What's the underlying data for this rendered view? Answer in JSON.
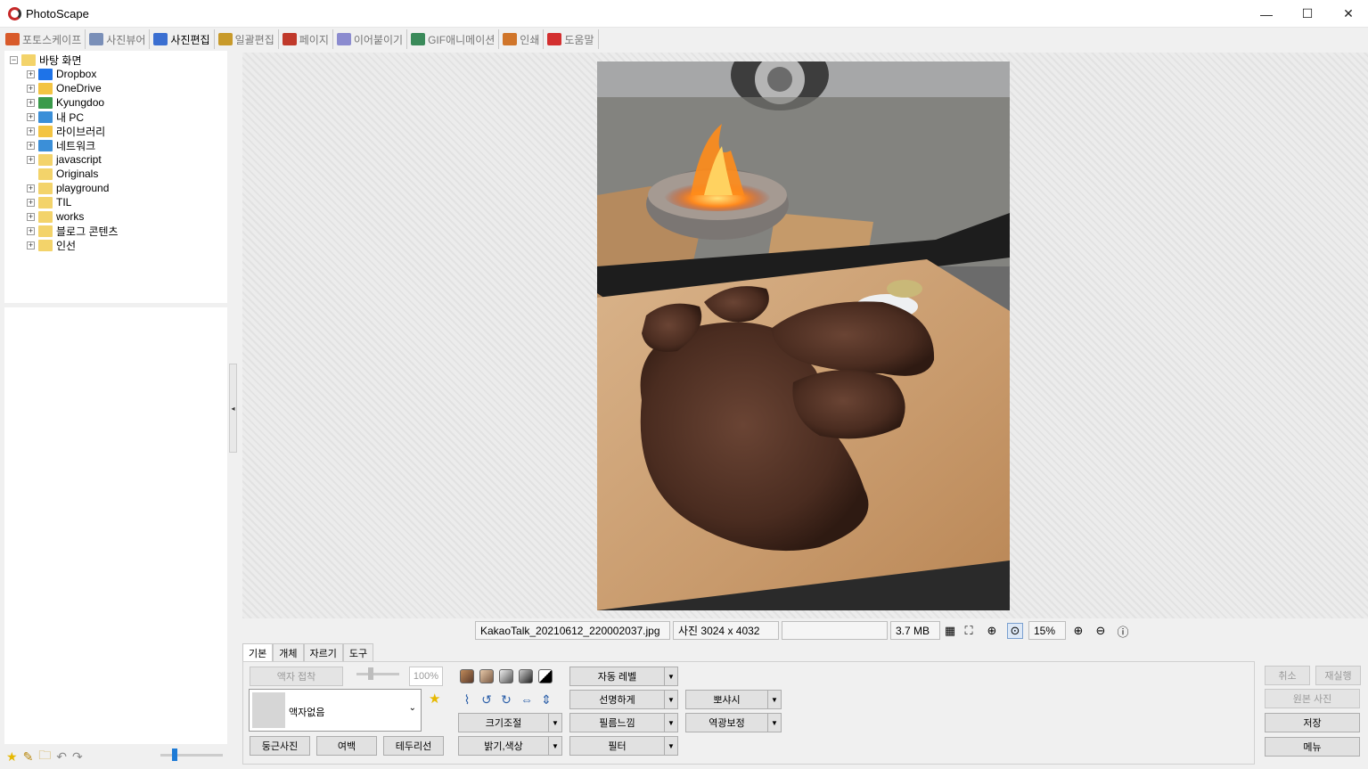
{
  "window": {
    "title": "PhotoScape",
    "controls": {
      "minimize": "—",
      "maximize": "☐",
      "close": "✕"
    }
  },
  "main_tabs": [
    {
      "label": "포토스케이프",
      "icon": "photoscape-icon",
      "color": "#d85a2a"
    },
    {
      "label": "사진뷰어",
      "icon": "viewer-icon",
      "color": "#7a8fb8"
    },
    {
      "label": "사진편집",
      "icon": "editor-icon",
      "color": "#3b6fd1",
      "active": true
    },
    {
      "label": "일괄편집",
      "icon": "batch-icon",
      "color": "#c89a2a"
    },
    {
      "label": "페이지",
      "icon": "page-icon",
      "color": "#c0392b"
    },
    {
      "label": "이어붙이기",
      "icon": "combine-icon",
      "color": "#8b8bcf"
    },
    {
      "label": "GIF애니메이션",
      "icon": "gif-icon",
      "color": "#3a8a5a"
    },
    {
      "label": "인쇄",
      "icon": "print-icon",
      "color": "#d0752a"
    },
    {
      "label": "도움말",
      "icon": "help-icon",
      "color": "#d32f2f"
    }
  ],
  "tree": {
    "root": "바탕 화면",
    "items": [
      {
        "label": "Dropbox",
        "icon": "dropbox-icon",
        "color": "#1e73e8"
      },
      {
        "label": "OneDrive",
        "icon": "folder-icon",
        "color": "#f3c442"
      },
      {
        "label": "Kyungdoo",
        "icon": "user-icon",
        "color": "#3a9a4a"
      },
      {
        "label": "내 PC",
        "icon": "pc-icon",
        "color": "#3b8fd8"
      },
      {
        "label": "라이브러리",
        "icon": "library-icon",
        "color": "#f3c442"
      },
      {
        "label": "네트워크",
        "icon": "network-icon",
        "color": "#3b8fd8"
      },
      {
        "label": "javascript",
        "icon": "folder-icon",
        "color": "#f3d36a"
      },
      {
        "label": "Originals",
        "icon": "folder-icon",
        "color": "#f3d36a"
      },
      {
        "label": "playground",
        "icon": "folder-icon",
        "color": "#f3d36a"
      },
      {
        "label": "TIL",
        "icon": "folder-icon",
        "color": "#f3d36a"
      },
      {
        "label": "works",
        "icon": "folder-icon",
        "color": "#f3d36a"
      },
      {
        "label": "블로그 콘텐츠",
        "icon": "folder-icon",
        "color": "#f3d36a"
      },
      {
        "label": "인선",
        "icon": "folder-icon",
        "color": "#f3d36a"
      }
    ]
  },
  "status": {
    "filename": "KakaoTalk_20210612_220002037.jpg",
    "dimensions": "사진 3024 x 4032",
    "filesize": "3.7 MB",
    "zoom": "15%"
  },
  "sub_tabs": [
    "기본",
    "개체",
    "자르기",
    "도구"
  ],
  "edit": {
    "frame_apply": "액자 접착",
    "frame_percent": "100%",
    "frame_none": "액자없음",
    "round_photo": "둥근사진",
    "margin": "여백",
    "border": "테두리선",
    "resize": "크기조절",
    "brightness": "밝기,색상",
    "auto_level": "자동 레벨",
    "sharpen": "선명하게",
    "film": "필름느낌",
    "filter": "필터",
    "bloom": "뽀샤시",
    "backlight": "역광보정"
  },
  "right_panel": {
    "undo": "취소",
    "redo": "재실행",
    "original": "원본 사진",
    "save": "저장",
    "menu": "메뉴"
  }
}
